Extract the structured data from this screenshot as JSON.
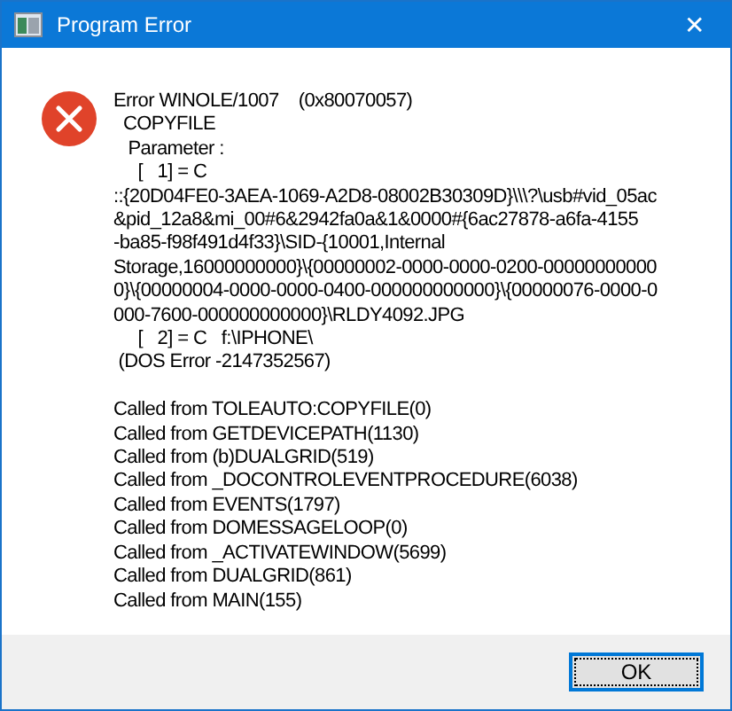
{
  "window": {
    "title": "Program Error",
    "close": "✕"
  },
  "message_lines": [
    "Error WINOLE/1007    (0x80070057)",
    "  COPYFILE",
    "   Parameter :",
    "     [   1] = C",
    "::{20D04FE0-3AEA-1069-A2D8-08002B30309D}\\\\\\?\\usb#vid_05ac",
    "&pid_12a8&mi_00#6&2942fa0a&1&0000#{6ac27878-a6fa-4155",
    "-ba85-f98f491d4f33}\\SID-{10001,Internal",
    "Storage,16000000000}\\{00000002-0000-0000-0200-00000000000",
    "0}\\{00000004-0000-0000-0400-000000000000}\\{00000076-0000-0",
    "000-7600-000000000000}\\RLDY4092.JPG",
    "     [   2] = C   f:\\IPHONE\\",
    " (DOS Error -2147352567)"
  ],
  "call_stack": [
    "Called from TOLEAUTO:COPYFILE(0)",
    "Called from GETDEVICEPATH(1130)",
    "Called from (b)DUALGRID(519)",
    "Called from _DOCONTROLEVENTPROCEDURE(6038)",
    "Called from EVENTS(1797)",
    "Called from DOMESSAGELOOP(0)",
    "Called from _ACTIVATEWINDOW(5699)",
    "Called from DUALGRID(861)",
    "Called from MAIN(155)"
  ],
  "buttons": [
    {
      "label": "OK",
      "selected": true
    }
  ]
}
